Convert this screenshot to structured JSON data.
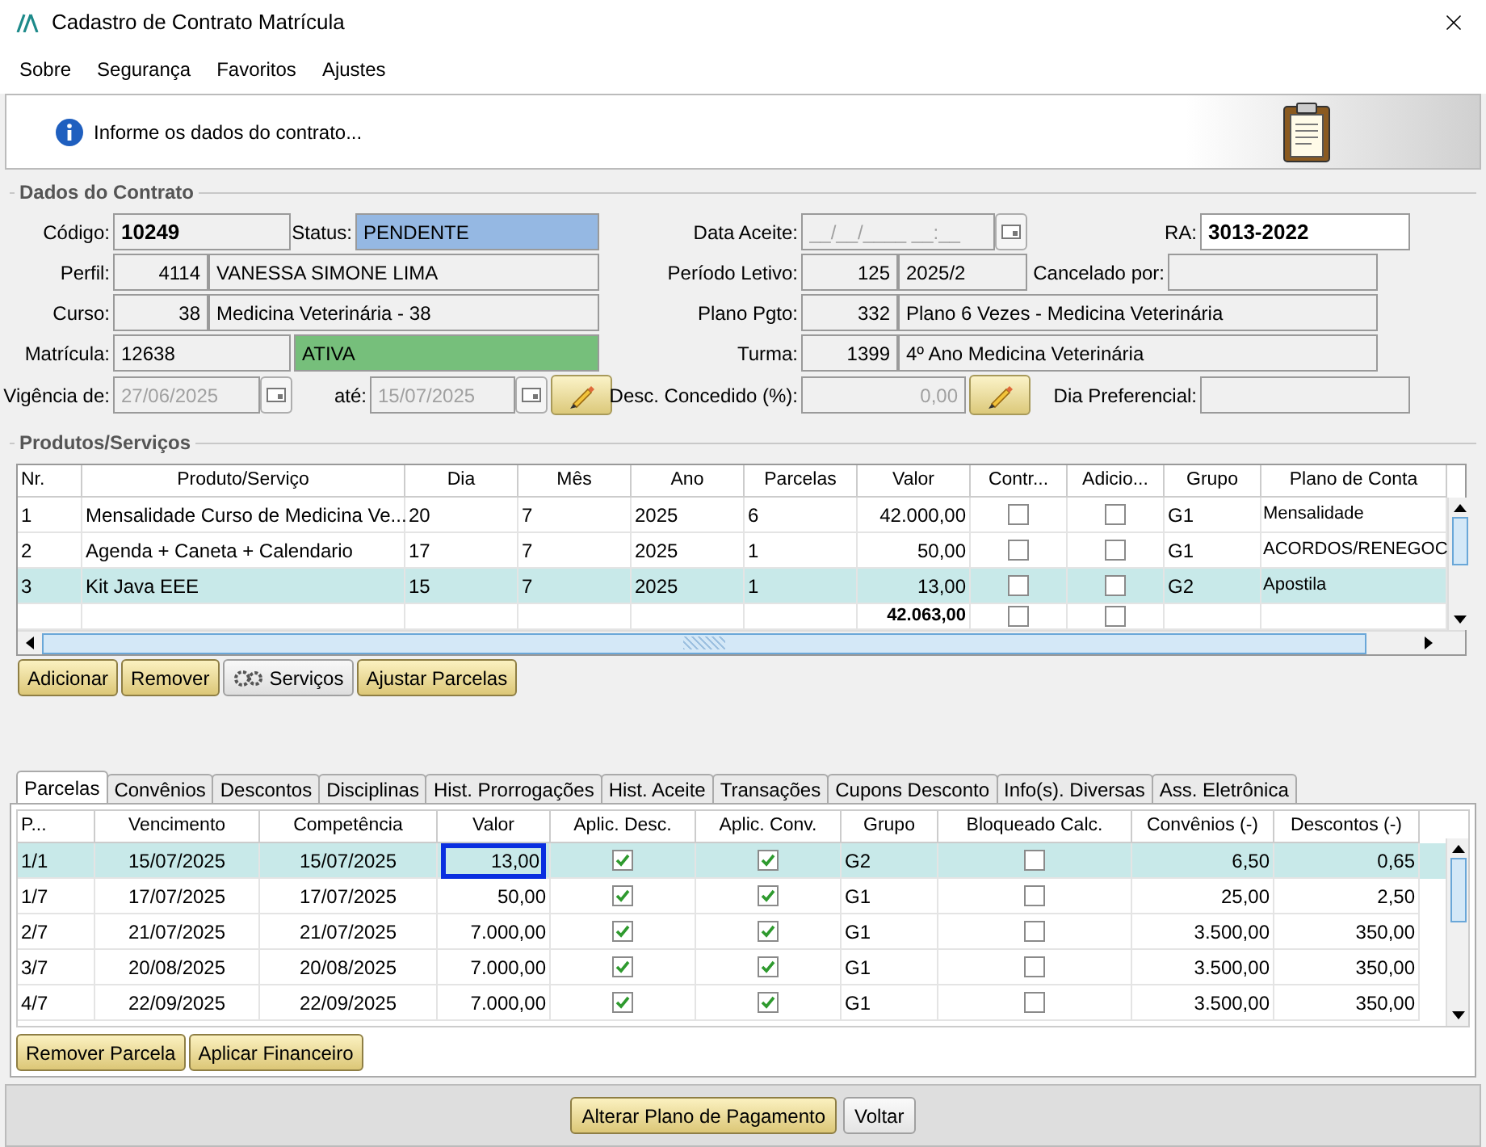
{
  "window": {
    "title": "Cadastro de Contrato Matrícula"
  },
  "menu": [
    "Sobre",
    "Segurança",
    "Favoritos",
    "Ajustes"
  ],
  "info": {
    "message": "Informe os dados do contrato..."
  },
  "contract": {
    "title": "Dados do Contrato",
    "codigo": {
      "label": "Código:",
      "value": "10249"
    },
    "status": {
      "label": "Status:",
      "value": "PENDENTE"
    },
    "perfil": {
      "label": "Perfil:",
      "code": "4114",
      "value": "VANESSA SIMONE LIMA"
    },
    "curso": {
      "label": "Curso:",
      "code": "38",
      "value": "Medicina Veterinária - 38"
    },
    "matricula": {
      "label": "Matrícula:",
      "value": "12638",
      "situation": "ATIVA"
    },
    "vigencia": {
      "label": "Vigência de:",
      "from": "27/06/2025",
      "to_label": "até:",
      "to": "15/07/2025",
      "disabled": true
    },
    "data_aceite": {
      "label": "Data Aceite:",
      "placeholder": "__/__/____ __:__"
    },
    "ra": {
      "label": "RA:",
      "value": "3013-2022"
    },
    "periodo": {
      "label": "Período Letivo:",
      "code": "125",
      "value": "2025/2"
    },
    "cancelado": {
      "label": "Cancelado por:"
    },
    "plano": {
      "label": "Plano Pgto:",
      "code": "332",
      "value": "Plano 6 Vezes - Medicina Veterinária"
    },
    "turma": {
      "label": "Turma:",
      "code": "1399",
      "value": "4º Ano Medicina Veterinária"
    },
    "desconto": {
      "label": "Desc. Concedido (%):",
      "value": "0,00",
      "disabled": true
    },
    "dia_preferencial": {
      "label": "Dia Preferencial:"
    }
  },
  "products": {
    "title": "Produtos/Serviços",
    "columns": [
      "Nr.",
      "Produto/Serviço",
      "Dia",
      "Mês",
      "Ano",
      "Parcelas",
      "Valor",
      "Contr...",
      "Adicio...",
      "Grupo",
      "Plano de Conta"
    ],
    "rows": [
      {
        "nr": "1",
        "produto": "Mensalidade Curso de Medicina Ve...",
        "dia": "20",
        "mes": "7",
        "ano": "2025",
        "parcelas": "6",
        "valor": "42.000,00",
        "contr": false,
        "adicio": false,
        "grupo": "G1",
        "plano": "Mensalidade",
        "selected": false
      },
      {
        "nr": "2",
        "produto": "Agenda + Caneta + Calendario",
        "dia": "17",
        "mes": "7",
        "ano": "2025",
        "parcelas": "1",
        "valor": "50,00",
        "contr": false,
        "adicio": false,
        "grupo": "G1",
        "plano": "ACORDOS/RENEGOC",
        "selected": false
      },
      {
        "nr": "3",
        "produto": "Kit Java EEE",
        "dia": "15",
        "mes": "7",
        "ano": "2025",
        "parcelas": "1",
        "valor": "13,00",
        "contr": false,
        "adicio": false,
        "grupo": "G2",
        "plano": "Apostila",
        "selected": true
      }
    ],
    "total": {
      "valor": "42.063,00",
      "contr": false,
      "adicio": false
    },
    "buttons": [
      "Adicionar",
      "Remover",
      "Serviços",
      "Ajustar Parcelas"
    ]
  },
  "tabs": [
    {
      "label": "Parcelas",
      "selected": true
    },
    {
      "label": "Convênios",
      "selected": false
    },
    {
      "label": "Descontos",
      "selected": false
    },
    {
      "label": "Disciplinas",
      "selected": false
    },
    {
      "label": "Hist. Prorrogações",
      "selected": false
    },
    {
      "label": "Hist. Aceite",
      "selected": false
    },
    {
      "label": "Transações",
      "selected": false
    },
    {
      "label": "Cupons Desconto",
      "selected": false
    },
    {
      "label": "Info(s). Diversas",
      "selected": false
    },
    {
      "label": "Ass. Eletrônica",
      "selected": false
    }
  ],
  "installments": {
    "columns": [
      "P...",
      "Vencimento",
      "Competência",
      "Valor",
      "Aplic. Desc.",
      "Aplic. Conv.",
      "Grupo",
      "Bloqueado Calc.",
      "Convênios (-)",
      "Descontos (-)"
    ],
    "rows": [
      {
        "parcela": "1/1",
        "vencimento": "15/07/2025",
        "competencia": "15/07/2025",
        "valor": "13,00",
        "aplic_desc": true,
        "aplic_conv": true,
        "grupo": "G2",
        "bloqueado": false,
        "convenios": "6,50",
        "descontos": "0,65",
        "selected": true,
        "valor_focused": true
      },
      {
        "parcela": "1/7",
        "vencimento": "17/07/2025",
        "competencia": "17/07/2025",
        "valor": "50,00",
        "aplic_desc": true,
        "aplic_conv": true,
        "grupo": "G1",
        "bloqueado": false,
        "convenios": "25,00",
        "descontos": "2,50",
        "selected": false,
        "valor_focused": false
      },
      {
        "parcela": "2/7",
        "vencimento": "21/07/2025",
        "competencia": "21/07/2025",
        "valor": "7.000,00",
        "aplic_desc": true,
        "aplic_conv": true,
        "grupo": "G1",
        "bloqueado": false,
        "convenios": "3.500,00",
        "descontos": "350,00",
        "selected": false,
        "valor_focused": false
      },
      {
        "parcela": "3/7",
        "vencimento": "20/08/2025",
        "competencia": "20/08/2025",
        "valor": "7.000,00",
        "aplic_desc": true,
        "aplic_conv": true,
        "grupo": "G1",
        "bloqueado": false,
        "convenios": "3.500,00",
        "descontos": "350,00",
        "selected": false,
        "valor_focused": false
      },
      {
        "parcela": "4/7",
        "vencimento": "22/09/2025",
        "competencia": "22/09/2025",
        "valor": "7.000,00",
        "aplic_desc": true,
        "aplic_conv": true,
        "grupo": "G1",
        "bloqueado": false,
        "convenios": "3.500,00",
        "descontos": "350,00",
        "selected": false,
        "valor_focused": false
      }
    ],
    "buttons": [
      "Remover Parcela",
      "Aplicar Financeiro"
    ]
  },
  "footer_buttons": [
    "Alterar Plano de Pagamento",
    "Voltar"
  ]
}
